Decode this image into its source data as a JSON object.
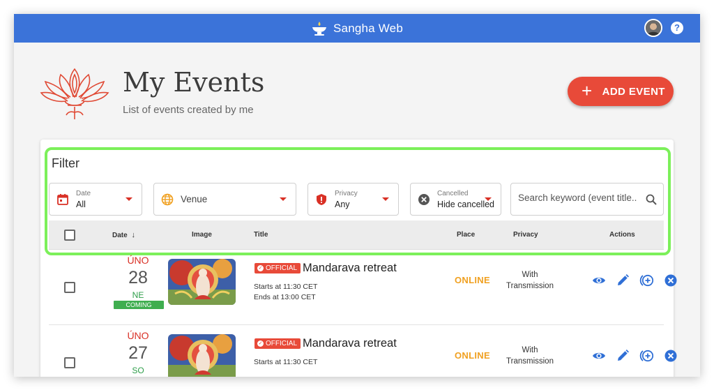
{
  "app": {
    "title": "Sangha Web"
  },
  "header": {
    "title": "My Events",
    "subtitle": "List of events created by me",
    "add_button_label": "ADD EVENT"
  },
  "filter": {
    "title": "Filter",
    "date": {
      "label": "Date",
      "value": "All"
    },
    "venue": {
      "placeholder": "Venue"
    },
    "privacy": {
      "label": "Privacy",
      "value": "Any"
    },
    "cancelled": {
      "label": "Cancelled",
      "value": "Hide cancelled"
    },
    "search": {
      "placeholder": "Search keyword (event title..."
    }
  },
  "table": {
    "columns": {
      "date": "Date",
      "image": "Image",
      "title": "Title",
      "place": "Place",
      "privacy": "Privacy",
      "actions": "Actions"
    },
    "sort_indicator": "↓",
    "rows": [
      {
        "weekday": "ÚNO",
        "day": "28",
        "month": "NE",
        "status": "COMING",
        "badge": "OFFICIAL",
        "title": "Mandarava retreat",
        "starts": "Starts at 11:30 CET",
        "ends": "Ends at 13:00 CET",
        "place": "ONLINE",
        "privacy_line1": "With",
        "privacy_line2": "Transmission"
      },
      {
        "weekday": "ÚNO",
        "day": "27",
        "month": "SO",
        "status": "",
        "badge": "OFFICIAL",
        "title": "Mandarava retreat",
        "starts": "Starts at 11:30 CET",
        "ends": "",
        "place": "ONLINE",
        "privacy_line1": "With",
        "privacy_line2": "Transmission"
      }
    ]
  },
  "icons": {
    "logo": "oil-lamp-icon",
    "help": "help-icon",
    "date": "calendar-icon",
    "venue": "globe-icon",
    "privacy": "shield-icon",
    "cancelled": "cancel-circle-icon",
    "search": "search-icon",
    "view": "eye-icon",
    "edit": "pencil-icon",
    "copy": "add-circle-icon",
    "delete": "close-circle-icon"
  },
  "colors": {
    "appbar": "#3b73d9",
    "accent": "#e84a39",
    "filter_highlight": "#7cf05a",
    "online": "#f0a020",
    "coming": "#3fae4f",
    "action": "#2f6fd6"
  }
}
